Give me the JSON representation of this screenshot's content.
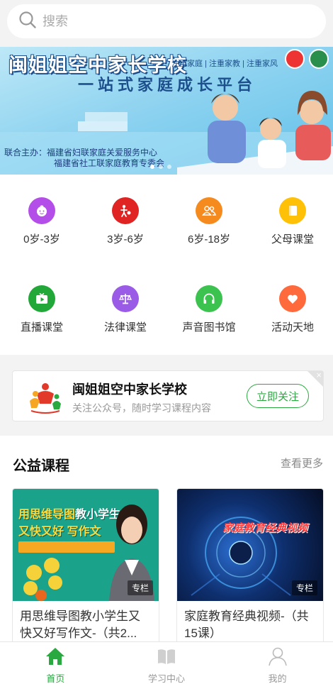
{
  "search": {
    "placeholder": "搜索"
  },
  "banner": {
    "title": "闽姐姐空中家长学校",
    "tags": "注重家庭 | 注重家教 | 注重家风",
    "subtitle": "一站式家庭成长平台",
    "organizer_line1": "联合主办：福建省妇联家庭关爱服务中心",
    "organizer_line2": "福建省社工联家庭教育专委会"
  },
  "categories": [
    {
      "label": "0岁-3岁",
      "icon": "baby-face-icon",
      "color": "#b44ee8"
    },
    {
      "label": "3岁-6岁",
      "icon": "child-play-icon",
      "color": "#e02424"
    },
    {
      "label": "6岁-18岁",
      "icon": "users-icon",
      "color": "#f58a1f"
    },
    {
      "label": "父母课堂",
      "icon": "book-icon",
      "color": "#ffc107"
    },
    {
      "label": "直播课堂",
      "icon": "tv-play-icon",
      "color": "#22a838"
    },
    {
      "label": "法律课堂",
      "icon": "scales-icon",
      "color": "#9a5ce6"
    },
    {
      "label": "声音图书馆",
      "icon": "headphones-icon",
      "color": "#3cc24f"
    },
    {
      "label": "活动天地",
      "icon": "heart-icon",
      "color": "#ff6a3d"
    }
  ],
  "follow": {
    "title": "闽姐姐空中家长学校",
    "subtitle": "关注公众号，随时学习课程内容",
    "button": "立即关注",
    "close": "×"
  },
  "courses": {
    "title": "公益课程",
    "more": "查看更多",
    "items": [
      {
        "title": "用思维导图教小学生又快又好写作文-（共2...",
        "tag": "专栏",
        "thumb_line1_a": "用思维导图",
        "thumb_line1_b": "教小学生",
        "thumb_line2": "又快又好 写作文"
      },
      {
        "title": "家庭教育经典视频-（共15课）",
        "tag": "专栏",
        "thumb_text": "家庭教育经典视频"
      }
    ]
  },
  "tabbar": [
    {
      "label": "首页",
      "icon": "home-icon",
      "active": true
    },
    {
      "label": "学习中心",
      "icon": "open-book-icon",
      "active": false
    },
    {
      "label": "我的",
      "icon": "user-icon",
      "active": false
    }
  ],
  "colors": {
    "accent": "#2aa940",
    "banner_blue": "#5fc0ea"
  }
}
